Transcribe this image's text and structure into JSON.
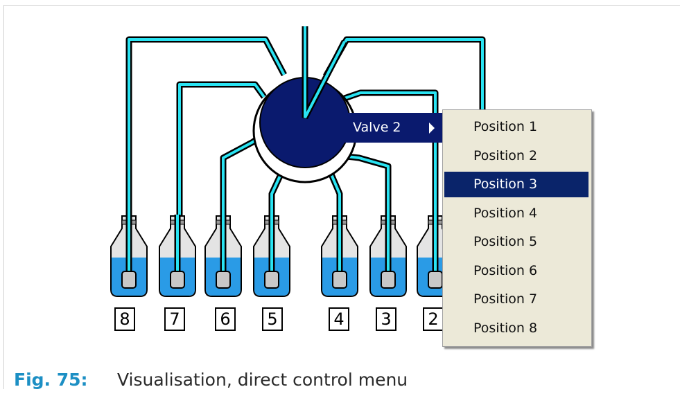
{
  "ports": [
    {
      "label": "8"
    },
    {
      "label": "7"
    },
    {
      "label": "6"
    },
    {
      "label": "5"
    },
    {
      "label": "4"
    },
    {
      "label": "3"
    },
    {
      "label": "2"
    }
  ],
  "context_menu": {
    "valve_item_label": "Valve 2",
    "submenu_items": [
      {
        "label": "Position 1",
        "selected": false
      },
      {
        "label": "Position 2",
        "selected": false
      },
      {
        "label": "Position 3",
        "selected": true
      },
      {
        "label": "Position 4",
        "selected": false
      },
      {
        "label": "Position 5",
        "selected": false
      },
      {
        "label": "Position 6",
        "selected": false
      },
      {
        "label": "Position 7",
        "selected": false
      },
      {
        "label": "Position 8",
        "selected": false
      }
    ]
  },
  "caption": {
    "label": "Fig. 75:",
    "text": "Visualisation, direct control menu"
  },
  "colors": {
    "tubing": "#29e3f2",
    "valve_body": "#0a1a6e",
    "liquid": "#2a9be6",
    "menu_background": "#ece9d8",
    "menu_highlight": "#0a246a",
    "caption_label": "#1c8fc4"
  }
}
